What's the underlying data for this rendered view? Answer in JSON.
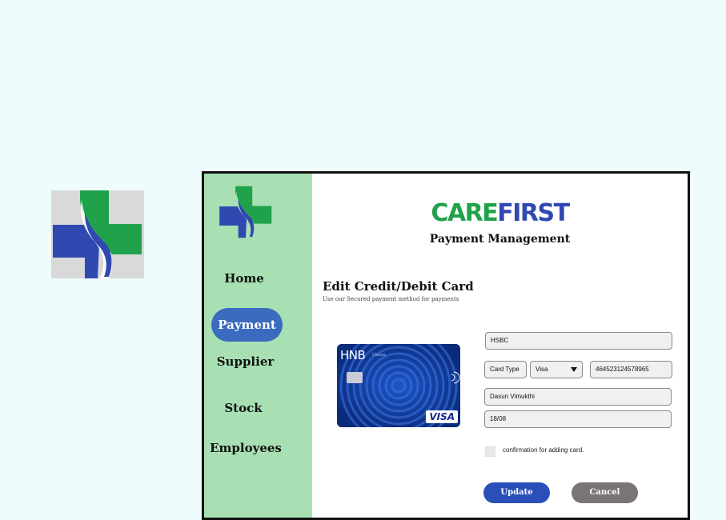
{
  "brand": {
    "name_part1": "CARE",
    "name_part2": "FIRST",
    "colors": {
      "green": "#1fa24a",
      "blue": "#2f49b0"
    }
  },
  "logo_icon": "medical-cross-icon",
  "header": {
    "subtitle": "Payment Management"
  },
  "sidebar": {
    "items": [
      {
        "label": "Home",
        "active": false
      },
      {
        "label": "Payment",
        "active": true
      },
      {
        "label": "Supplier",
        "active": false
      },
      {
        "label": "Stock",
        "active": false
      },
      {
        "label": "Employees",
        "active": false
      }
    ],
    "background": "#a8e0b4",
    "active_color": "#3a6bbf"
  },
  "section": {
    "title": "Edit Credit/Debit Card",
    "hint": "Use our Secured payment method for payments"
  },
  "card": {
    "bank": "HNB",
    "tier": "Classic",
    "network": "VISA"
  },
  "form": {
    "bank_value": "HSBC",
    "card_type_label": "Card Type",
    "card_type_value": "Visa",
    "card_number_value": "464523124578965",
    "holder_name_value": "Dasun Vimukthi",
    "expiry_value": "18/08",
    "confirm_label": "confirmation for adding card.",
    "confirm_checked": false
  },
  "buttons": {
    "update_label": "Update",
    "cancel_label": "Cancel"
  }
}
